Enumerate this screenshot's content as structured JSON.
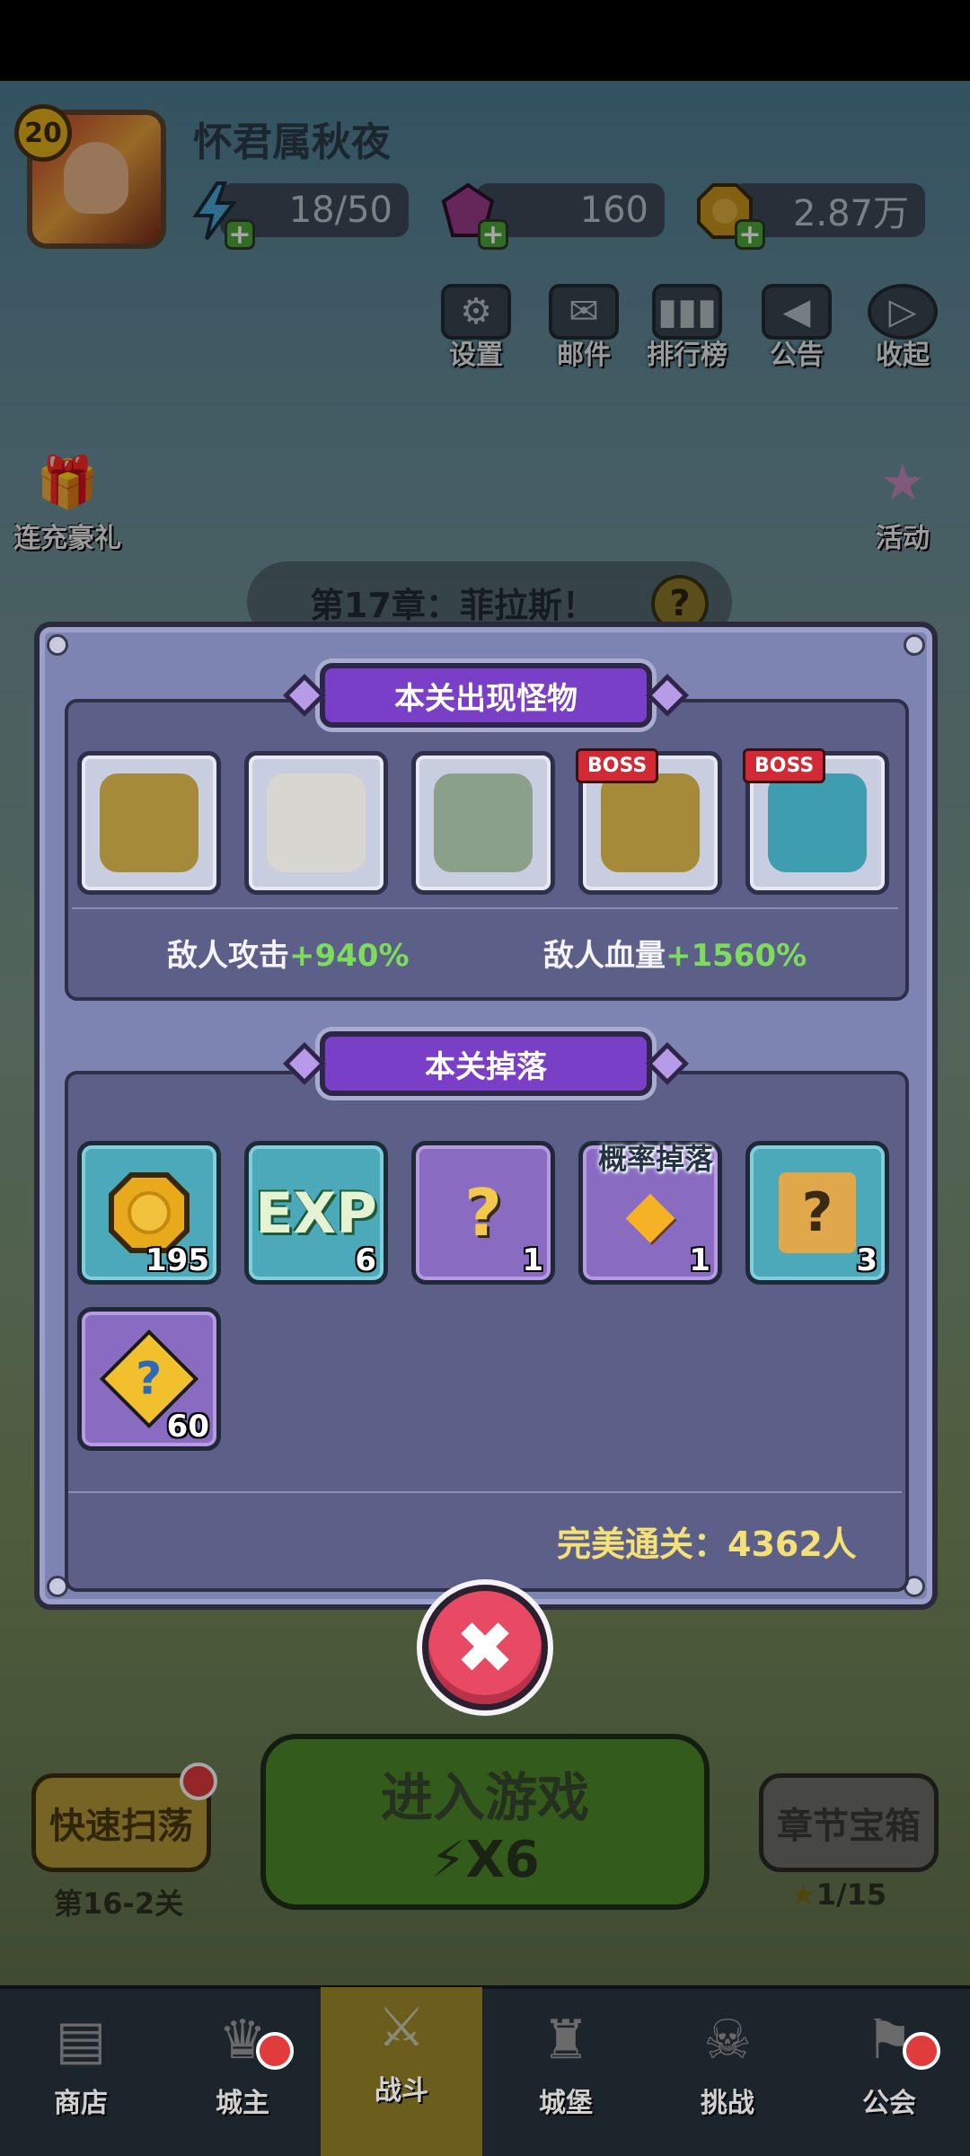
{
  "player": {
    "level": "20",
    "name": "怀君属秋夜"
  },
  "resources": {
    "energy": "18/50",
    "gems": "160",
    "gold": "2.87万"
  },
  "top_menu": [
    {
      "label": "设置",
      "icon": "gear-icon"
    },
    {
      "label": "邮件",
      "icon": "mail-icon"
    },
    {
      "label": "排行榜",
      "icon": "ranking-icon"
    },
    {
      "label": "公告",
      "icon": "megaphone-icon"
    },
    {
      "label": "收起",
      "icon": "collapse-icon"
    }
  ],
  "side_left": {
    "label": "连充豪礼"
  },
  "side_right": {
    "label": "活动"
  },
  "chapter": {
    "title": "第17章：菲拉斯！"
  },
  "modal": {
    "monsters_title": "本关出现怪物",
    "monsters": [
      {
        "boss": false,
        "color": "#a58a3a"
      },
      {
        "boss": false,
        "color": "#d8d6d0"
      },
      {
        "boss": false,
        "color": "#8aa088"
      },
      {
        "boss": true,
        "boss_label": "BOSS",
        "color": "#a58a3a"
      },
      {
        "boss": true,
        "boss_label": "BOSS",
        "color": "#3f9db0"
      }
    ],
    "enemy_attack_label": "敌人攻击",
    "enemy_attack_value": "+940%",
    "enemy_hp_label": "敌人血量",
    "enemy_hp_value": "+1560%",
    "drops_title": "本关掉落",
    "drops": [
      {
        "name": "gold-coin",
        "count": "195",
        "style": "blue",
        "icon_text": "⬢"
      },
      {
        "name": "exp",
        "count": "6",
        "style": "blue",
        "icon_text": "EXP"
      },
      {
        "name": "random-gems",
        "count": "1",
        "style": "purple",
        "icon_text": "?"
      },
      {
        "name": "rune",
        "count": "1",
        "style": "purple",
        "icon_text": "◆",
        "label": "概率掉落"
      },
      {
        "name": "mystery-scroll",
        "count": "3",
        "style": "blue",
        "icon_text": "?"
      },
      {
        "name": "puzzle-piece",
        "count": "60",
        "style": "purple",
        "icon_text": "?"
      }
    ],
    "perfect_clear": "完美通关：4362人"
  },
  "bottom": {
    "sweep_label": "快速扫荡",
    "sweep_stage": "第16-2关",
    "enter_label": "进入游戏",
    "enter_cost": "X6",
    "chest_label": "章节宝箱",
    "chest_progress": "1/15"
  },
  "nav": [
    {
      "label": "商店",
      "icon": "shop-icon"
    },
    {
      "label": "城主",
      "icon": "crown-icon"
    },
    {
      "label": "战斗",
      "icon": "swords-icon"
    },
    {
      "label": "城堡",
      "icon": "castle-icon"
    },
    {
      "label": "挑战",
      "icon": "challenge-icon"
    },
    {
      "label": "公会",
      "icon": "guild-icon"
    }
  ],
  "colors": {
    "accent_purple": "#7a3fc7",
    "stat_green": "#7ddc5b",
    "perfect_yellow": "#f3e178",
    "close_red": "#e84a63"
  }
}
